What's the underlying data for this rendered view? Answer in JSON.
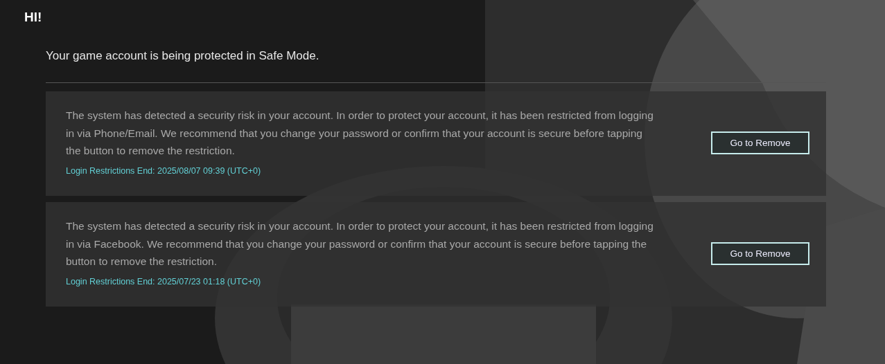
{
  "greeting": "HI!",
  "subtitle": "Your game account is being protected in Safe Mode.",
  "restrictions": [
    {
      "message": "The system has detected a security risk in your account. In order to protect your account, it has been restricted from logging in via Phone/Email. We recommend that you change your password or confirm that your account is secure before tapping the button to remove the restriction.",
      "end_time": "Login Restrictions End: 2025/08/07 09:39 (UTC+0)",
      "button": "Go to Remove"
    },
    {
      "message": "The system has detected a security risk in your account. In order to protect your account, it has been restricted from logging in via Facebook. We recommend that you change your password or confirm that your account is secure before tapping the button to remove the restriction.",
      "end_time": "Login Restrictions End: 2025/07/23 01:18 (UTC+0)",
      "button": "Go to Remove"
    }
  ]
}
